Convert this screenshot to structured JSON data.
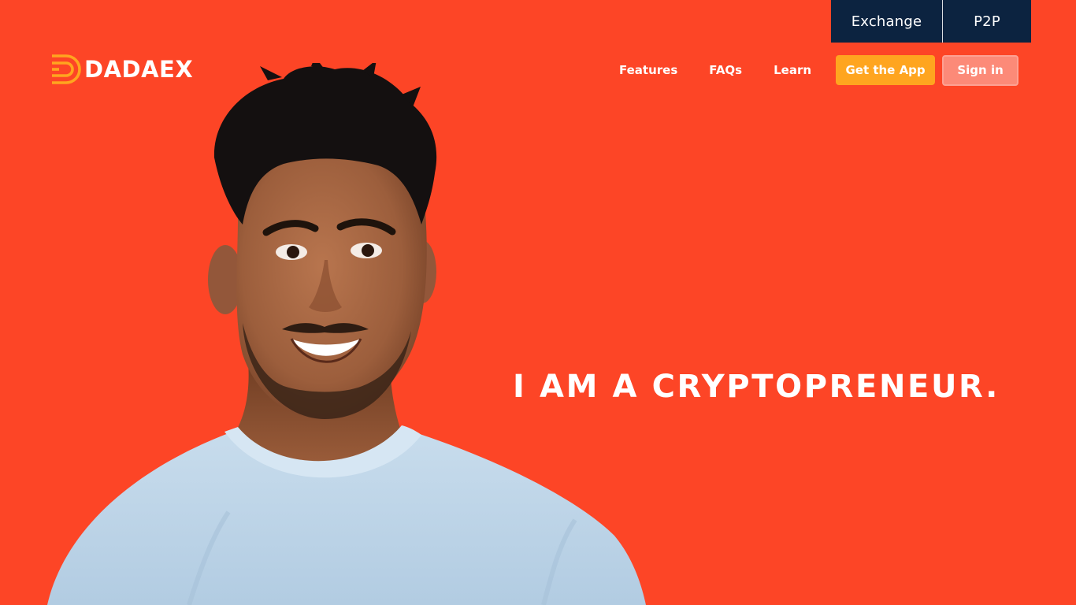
{
  "switcher": {
    "exchange_label": "Exchange",
    "p2p_label": "P2P"
  },
  "brand": {
    "name": "DADAEX",
    "logo_icon": "dadaex-logo-icon"
  },
  "nav": {
    "features_label": "Features",
    "faqs_label": "FAQs",
    "learn_label": "Learn",
    "get_app_label": "Get the App",
    "sign_in_label": "Sign in"
  },
  "hero": {
    "headline": "I AM A CRYPTOPRENEUR.",
    "photo_icon": "smiling-man-portrait"
  },
  "colors": {
    "background": "#FD4526",
    "switcher_bg": "#0C2340",
    "get_app_bg": "#FFA51F",
    "sign_in_bg": "#FC8A78",
    "logo_accent": "#FFA51F"
  }
}
